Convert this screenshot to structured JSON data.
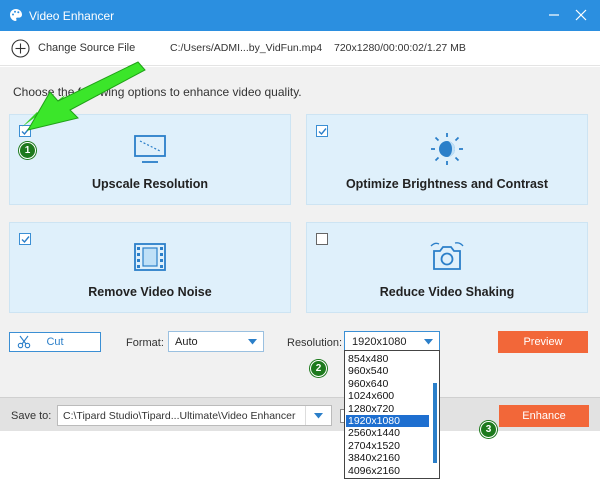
{
  "window": {
    "title": "Video Enhancer"
  },
  "source": {
    "change_label": "Change Source File",
    "file_path": "C:/Users/ADMI...by_VidFun.mp4",
    "file_info": "720x1280/00:00:02/1.27 MB"
  },
  "intro_text": "Choose the following options to enhance video quality.",
  "options": [
    {
      "label": "Upscale Resolution",
      "checked": true,
      "icon": "monitor-icon"
    },
    {
      "label": "Optimize Brightness and Contrast",
      "checked": true,
      "icon": "brightness-icon"
    },
    {
      "label": "Remove Video Noise",
      "checked": true,
      "icon": "film-icon"
    },
    {
      "label": "Reduce Video Shaking",
      "checked": false,
      "icon": "camera-icon"
    }
  ],
  "controls": {
    "cut_label": "Cut",
    "format_label": "Format:",
    "format_value": "Auto",
    "resolution_label": "Resolution:",
    "resolution_value": "1920x1080",
    "preview_label": "Preview"
  },
  "resolution_options": [
    "854x480",
    "960x540",
    "960x640",
    "1024x600",
    "1280x720",
    "1920x1080",
    "2560x1440",
    "2704x1520",
    "3840x2160",
    "4096x2160"
  ],
  "resolution_selected_index": 5,
  "footer": {
    "save_label": "Save to:",
    "save_path": "C:\\Tipard Studio\\Tipard...Ultimate\\Video Enhancer",
    "enhance_label": "Enhance"
  },
  "annotations": {
    "badge1": "1",
    "badge2": "2",
    "badge3": "3"
  },
  "colors": {
    "titlebar": "#2b8fe0",
    "accent": "#3b8fd4",
    "action": "#f26739",
    "card_bg": "#dff0fb",
    "annotation": "#1d7a1d",
    "arrow": "#35d125"
  }
}
